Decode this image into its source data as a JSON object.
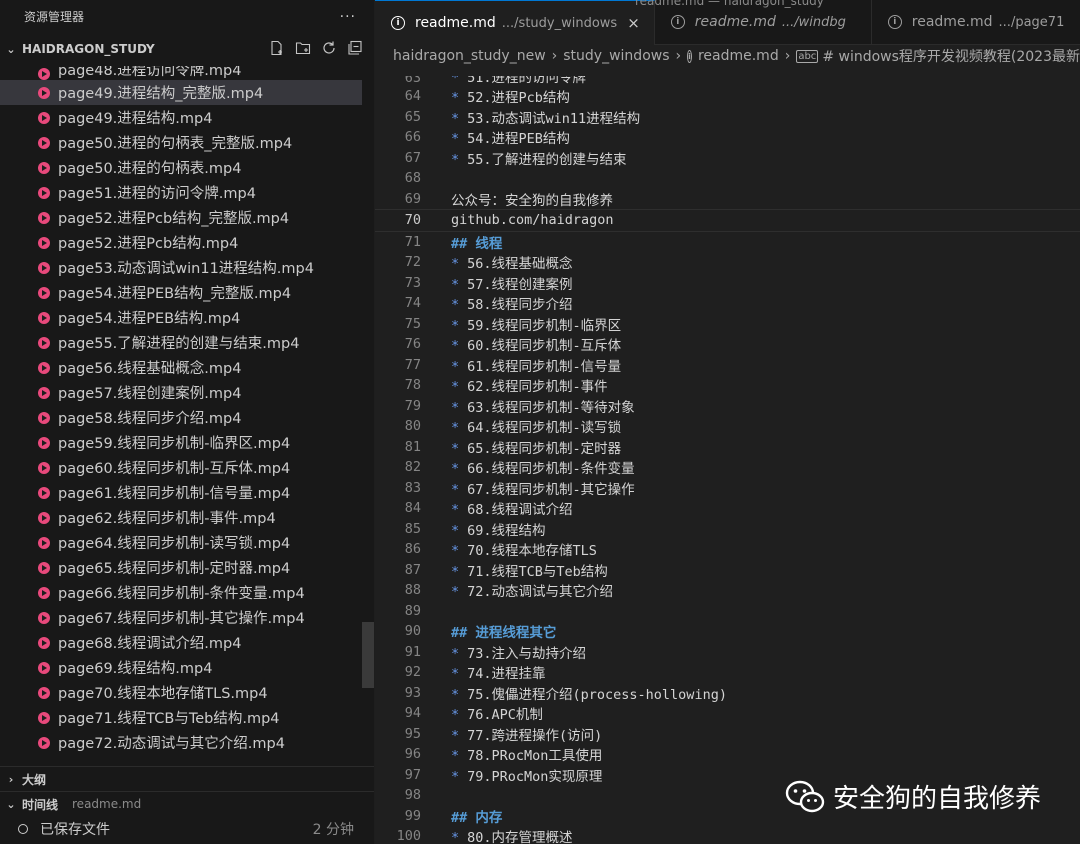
{
  "window": {
    "title": "readme.md — haidragon_study"
  },
  "sidebar": {
    "title": "资源管理器",
    "more": "···",
    "folder": "HAIDRAGON_STUDY",
    "partial_item": "page48.进程访问令牌.mp4",
    "files": [
      "page49.进程结构_完整版.mp4",
      "page49.进程结构.mp4",
      "page50.进程的句柄表_完整版.mp4",
      "page50.进程的句柄表.mp4",
      "page51.进程的访问令牌.mp4",
      "page52.进程Pcb结构_完整版.mp4",
      "page52.进程Pcb结构.mp4",
      "page53.动态调试win11进程结构.mp4",
      "page54.进程PEB结构_完整版.mp4",
      "page54.进程PEB结构.mp4",
      "page55.了解进程的创建与结束.mp4",
      "page56.线程基础概念.mp4",
      "page57.线程创建案例.mp4",
      "page58.线程同步介绍.mp4",
      "page59.线程同步机制-临界区.mp4",
      "page60.线程同步机制-互斥体.mp4",
      "page61.线程同步机制-信号量.mp4",
      "page62.线程同步机制-事件.mp4",
      "page64.线程同步机制-读写锁.mp4",
      "page65.线程同步机制-定时器.mp4",
      "page66.线程同步机制-条件变量.mp4",
      "page67.线程同步机制-其它操作.mp4",
      "page68.线程调试介绍.mp4",
      "page69.线程结构.mp4",
      "page70.线程本地存储TLS.mp4",
      "page71.线程TCB与Teb结构.mp4",
      "page72.动态调试与其它介绍.mp4"
    ],
    "outline_label": "大纲",
    "timeline_label": "时间线",
    "timeline_file": "readme.md",
    "timeline_entry": "已保存文件",
    "timeline_time": "2 分钟"
  },
  "tabs": [
    {
      "name": "readme.md",
      "path": ".../study_windows",
      "close": "×"
    },
    {
      "name": "readme.md",
      "path": ".../windbg"
    },
    {
      "name": "readme.md",
      "path": ".../page71"
    }
  ],
  "breadcrumb": [
    "haidragon_study_new",
    "study_windows",
    "readme.md",
    "# windows程序开发视频教程(2023最新"
  ],
  "code": {
    "partial": {
      "num": "63",
      "text": "51.进程的访问令牌"
    },
    "lines": [
      {
        "num": "64",
        "text": "52.进程Pcb结构",
        "bullet": true
      },
      {
        "num": "65",
        "text": "53.动态调试win11进程结构",
        "bullet": true
      },
      {
        "num": "66",
        "text": "54.进程PEB结构",
        "bullet": true
      },
      {
        "num": "67",
        "text": "55.了解进程的创建与结束",
        "bullet": true
      },
      {
        "num": "68",
        "text": ""
      },
      {
        "num": "69",
        "text": "公众号：安全狗的自我修养"
      },
      {
        "num": "70",
        "text": "github.com/haidragon",
        "current": true
      },
      {
        "num": "71",
        "text": "## 线程",
        "heading": true
      },
      {
        "num": "72",
        "text": "56.线程基础概念",
        "bullet": true
      },
      {
        "num": "73",
        "text": "57.线程创建案例",
        "bullet": true
      },
      {
        "num": "74",
        "text": "58.线程同步介绍",
        "bullet": true
      },
      {
        "num": "75",
        "text": "59.线程同步机制-临界区",
        "bullet": true
      },
      {
        "num": "76",
        "text": "60.线程同步机制-互斥体",
        "bullet": true
      },
      {
        "num": "77",
        "text": "61.线程同步机制-信号量",
        "bullet": true
      },
      {
        "num": "78",
        "text": "62.线程同步机制-事件",
        "bullet": true
      },
      {
        "num": "79",
        "text": "63.线程同步机制-等待对象",
        "bullet": true
      },
      {
        "num": "80",
        "text": "64.线程同步机制-读写锁",
        "bullet": true
      },
      {
        "num": "81",
        "text": "65.线程同步机制-定时器",
        "bullet": true
      },
      {
        "num": "82",
        "text": "66.线程同步机制-条件变量",
        "bullet": true
      },
      {
        "num": "83",
        "text": "67.线程同步机制-其它操作",
        "bullet": true
      },
      {
        "num": "84",
        "text": "68.线程调试介绍",
        "bullet": true
      },
      {
        "num": "85",
        "text": "69.线程结构",
        "bullet": true
      },
      {
        "num": "86",
        "text": "70.线程本地存储TLS",
        "bullet": true
      },
      {
        "num": "87",
        "text": "71.线程TCB与Teb结构",
        "bullet": true
      },
      {
        "num": "88",
        "text": "72.动态调试与其它介绍",
        "bullet": true
      },
      {
        "num": "89",
        "text": ""
      },
      {
        "num": "90",
        "text": "## 进程线程其它",
        "heading": true
      },
      {
        "num": "91",
        "text": "73.注入与劫持介绍",
        "bullet": true
      },
      {
        "num": "92",
        "text": "74.进程挂靠",
        "bullet": true
      },
      {
        "num": "93",
        "text": "75.傀儡进程介绍(process-hollowing)",
        "bullet": true
      },
      {
        "num": "94",
        "text": "76.APC机制",
        "bullet": true
      },
      {
        "num": "95",
        "text": "77.跨进程操作(访问)",
        "bullet": true
      },
      {
        "num": "96",
        "text": "78.PRocMon工具使用",
        "bullet": true
      },
      {
        "num": "97",
        "text": "79.PRocMon实现原理",
        "bullet": true
      },
      {
        "num": "98",
        "text": ""
      },
      {
        "num": "99",
        "text": "## 内存",
        "heading": true
      },
      {
        "num": "100",
        "text": "80.内存管理概述",
        "bullet": true
      }
    ]
  },
  "watermark": {
    "text": "安全狗的自我修养"
  },
  "colors": {
    "mp4_icon": "#e8497c",
    "heading": "#569cd6",
    "bullet": "#6796e6",
    "accent": "#0078d4"
  }
}
